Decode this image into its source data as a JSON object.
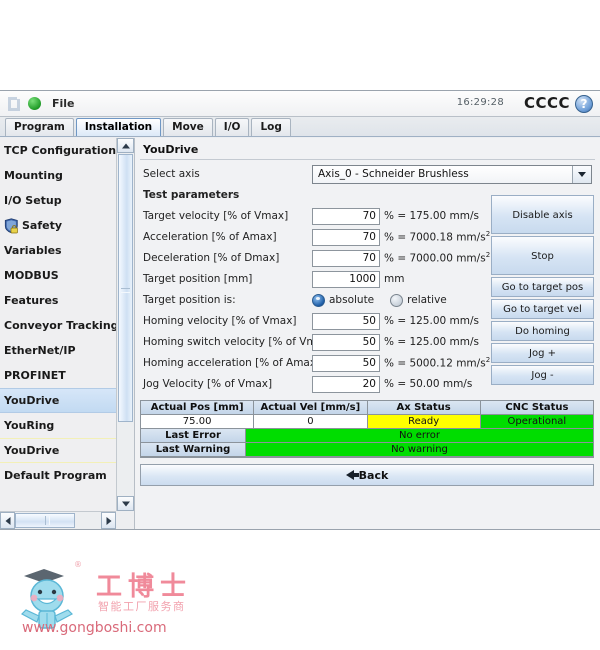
{
  "menubar": {
    "file_label": "File",
    "clock": "16:29:28",
    "brand": "CCCC",
    "help_glyph": "?"
  },
  "tabs": [
    {
      "label": "Program",
      "active": false
    },
    {
      "label": "Installation",
      "active": true
    },
    {
      "label": "Move",
      "active": false
    },
    {
      "label": "I/O",
      "active": false
    },
    {
      "label": "Log",
      "active": false
    }
  ],
  "sidebar": {
    "items": [
      {
        "label": "TCP Configuration",
        "state": "normal"
      },
      {
        "label": "Mounting",
        "state": "normal"
      },
      {
        "label": "I/O Setup",
        "state": "normal"
      },
      {
        "label": "Safety",
        "state": "normal",
        "icon": "shield-icon"
      },
      {
        "label": "Variables",
        "state": "normal"
      },
      {
        "label": "MODBUS",
        "state": "normal"
      },
      {
        "label": "Features",
        "state": "normal"
      },
      {
        "label": "Conveyor Tracking",
        "state": "normal"
      },
      {
        "label": "EtherNet/IP",
        "state": "normal"
      },
      {
        "label": "PROFINET",
        "state": "normal"
      },
      {
        "label": "YouDrive",
        "state": "selected"
      },
      {
        "label": "YouRing",
        "state": "normal"
      },
      {
        "label": "YouDrive",
        "state": "highlight"
      },
      {
        "label": "Default Program",
        "state": "normal"
      }
    ]
  },
  "main": {
    "panel_title": "YouDrive",
    "select_axis_label": "Select axis",
    "select_axis_value": "Axis_0 - Schneider Brushless",
    "test_parameters_label": "Test parameters",
    "parameters": [
      {
        "label": "Target velocity [% of Vmax]",
        "value": "70",
        "unit": "% = 175.00 mm/s",
        "sup": ""
      },
      {
        "label": "Acceleration [% of Amax]",
        "value": "70",
        "unit": "% = 7000.18 mm/s",
        "sup": "2"
      },
      {
        "label": "Deceleration [% of Dmax]",
        "value": "70",
        "unit": "% = 7000.00 mm/s",
        "sup": "2"
      },
      {
        "label": "Target position [mm]",
        "value": "1000",
        "unit": "mm",
        "sup": ""
      }
    ],
    "target_position_is_label": "Target position is:",
    "radio_absolute": "absolute",
    "radio_relative": "relative",
    "radio_selected": "absolute",
    "parameters2": [
      {
        "label": "Homing velocity [% of Vmax]",
        "value": "50",
        "unit": "% = 125.00 mm/s",
        "sup": ""
      },
      {
        "label": "Homing switch velocity [% of Vmax]",
        "value": "50",
        "unit": "% = 125.00 mm/s",
        "sup": ""
      },
      {
        "label": "Homing acceleration [% of Amax]",
        "value": "50",
        "unit": "% = 5000.12 mm/s",
        "sup": "2"
      },
      {
        "label": "Jog Velocity [% of Vmax]",
        "value": "20",
        "unit": "% = 50.00 mm/s",
        "sup": ""
      }
    ],
    "actions": [
      {
        "label": "Disable axis",
        "tall": true
      },
      {
        "label": "Stop",
        "tall": true
      },
      {
        "label": "Go to target pos",
        "tall": false
      },
      {
        "label": "Go to target vel",
        "tall": false
      },
      {
        "label": "Do homing",
        "tall": false
      },
      {
        "label": "Jog +",
        "tall": false
      },
      {
        "label": "Jog -",
        "tall": false
      }
    ],
    "status_table": {
      "headers": [
        "Actual Pos [mm]",
        "Actual Vel [mm/s]",
        "Ax Status",
        "CNC Status"
      ],
      "values": [
        "75.00",
        "0",
        "Ready",
        "Operational"
      ],
      "value_colors": [
        "#ffffff",
        "#ffffff",
        "#ffff00",
        "#00dd00"
      ],
      "last_error_label": "Last Error",
      "last_error_value": "No error",
      "last_warning_label": "Last Warning",
      "last_warning_value": "No warning"
    },
    "back_label": "Back"
  },
  "watermark": {
    "url": "www.gongboshi.com",
    "cn_name": "工博士",
    "cn_sub": "智能工厂服务商",
    "registered": "®"
  },
  "colors": {
    "accent": "#c2daf2",
    "status_ok": "#00dd00",
    "status_warn": "#ffff00",
    "panel_bg": "#f1f2f4"
  }
}
